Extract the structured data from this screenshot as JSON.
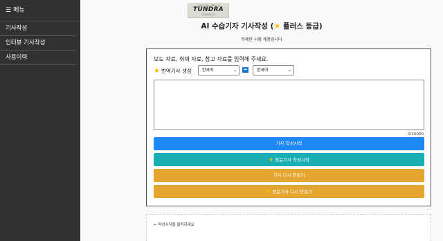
{
  "sidebar": {
    "menu_icon": "hamburger-icon",
    "title": "메뉴",
    "items": [
      {
        "label": "기사작성"
      },
      {
        "label": "인터뷰 기사작성"
      },
      {
        "label": "사용이력"
      }
    ]
  },
  "logo": {
    "tagline": "그날을 그날에 기록하는 힘",
    "brand": "TUNDRA",
    "subtitle": "주식회사툰드라"
  },
  "header": {
    "title_prefix": "AI 수습기자 기사작성 (",
    "title_suffix": " 플러스 등급)",
    "notice": "무제한 사용 계정입니다"
  },
  "form": {
    "instruction": "보도 자료, 취재 자료, 참고 자료를 입력해 주세요.",
    "translate_label": "번역기사 생성",
    "source_language": "한국어",
    "target_language": "한국어",
    "arrow_icon": "arrow-right-icon",
    "textarea_value": "",
    "char_counter": "0/10000"
  },
  "buttons": {
    "write": "기사 작성시작",
    "premium_write": "정문기사 작성시작",
    "rewrite": "기사 다시 만들기",
    "premium_rewrite": "정문기사 다시 만들기"
  },
  "result": {
    "label": "작성시작을 클릭하세요"
  },
  "colors": {
    "sidebar_bg": "#323232",
    "primary_blue": "#1e88f5",
    "teal": "#19aeb3",
    "orange": "#e5a630",
    "star": "#f2c200"
  }
}
